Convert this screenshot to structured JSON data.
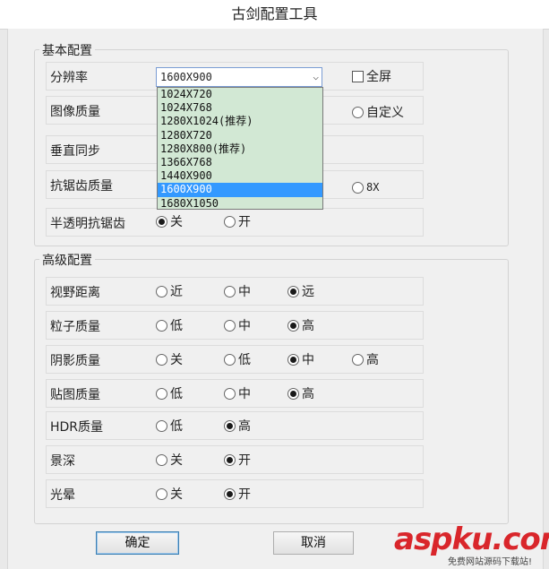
{
  "window": {
    "title": "古剑配置工具"
  },
  "basic": {
    "group_title": "基本配置",
    "resolution_label": "分辨率",
    "resolution_value": "1600X900",
    "fullscreen_label": "全屏",
    "image_quality_label": "图像质量",
    "image_quality_custom": "自定义",
    "vsync_label": "垂直同步",
    "aa_label": "抗锯齿质量",
    "aa_8x": "8X",
    "transparent_aa_label": "半透明抗锯齿",
    "transparent_aa_off": "关",
    "transparent_aa_on": "开"
  },
  "resolution_options": [
    "1024X720",
    "1024X768",
    "1280X1024(推荐)",
    "1280X720",
    "1280X800(推荐)",
    "1366X768",
    "1440X900",
    "1600X900",
    "1680X1050"
  ],
  "advanced": {
    "group_title": "高级配置",
    "view_distance": {
      "label": "视野距离",
      "opts": [
        "近",
        "中",
        "远"
      ],
      "selected": 2
    },
    "particle_quality": {
      "label": "粒子质量",
      "opts": [
        "低",
        "中",
        "高"
      ],
      "selected": 2
    },
    "shadow_quality": {
      "label": "阴影质量",
      "opts": [
        "关",
        "低",
        "中",
        "高"
      ],
      "selected": 2
    },
    "texture_quality": {
      "label": "贴图质量",
      "opts": [
        "低",
        "中",
        "高"
      ],
      "selected": 2
    },
    "hdr_quality": {
      "label": "HDR质量",
      "opts": [
        "低",
        "高"
      ],
      "selected": 1
    },
    "depth_of_field": {
      "label": "景深",
      "opts": [
        "关",
        "开"
      ],
      "selected": 1
    },
    "bloom": {
      "label": "光晕",
      "opts": [
        "关",
        "开"
      ],
      "selected": 1
    }
  },
  "buttons": {
    "ok": "确定",
    "cancel": "取消"
  },
  "watermark": {
    "main": "aspku.com",
    "sub": "免费网站源码下载站!"
  }
}
